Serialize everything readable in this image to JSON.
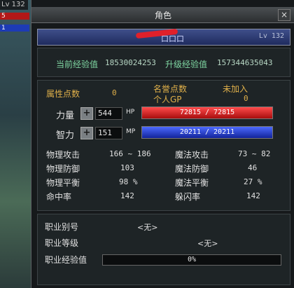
{
  "sidebar": {
    "level": "Lv 132",
    "hp_num": "5",
    "mp_num": "1"
  },
  "window": {
    "title": "角色",
    "close": "×"
  },
  "name_bar": {
    "level": "Lv 132",
    "name": "口口口"
  },
  "experience": {
    "current_label": "当前经验值",
    "current_value": "18530024253",
    "levelup_label": "升级经验值",
    "levelup_value": "157344635043"
  },
  "points": {
    "attr_label": "属性点数",
    "attr_value": "0",
    "fame_label": "名誉点数",
    "fame_value": "未加入",
    "gp_label": "个人GP",
    "gp_value": "0"
  },
  "attributes": [
    {
      "label": "力量",
      "value": "544",
      "unit": "HP",
      "gauge_text": "72815 / 72815",
      "fill": 1.0,
      "type": "hp"
    },
    {
      "label": "智力",
      "value": "151",
      "unit": "MP",
      "gauge_text": "20211 / 20211",
      "fill": 1.0,
      "type": "mp"
    }
  ],
  "combat": {
    "left": [
      {
        "label": "物理攻击",
        "value": "166 ~ 186"
      },
      {
        "label": "物理防御",
        "value": "103"
      },
      {
        "label": "物理平衡",
        "value": "98 %"
      },
      {
        "label": "命中率",
        "value": "142"
      }
    ],
    "right": [
      {
        "label": "魔法攻击",
        "value": "73 ~ 82"
      },
      {
        "label": "魔法防御",
        "value": "46"
      },
      {
        "label": "魔法平衡",
        "value": "27 %"
      },
      {
        "label": "躲闪率",
        "value": "142"
      }
    ]
  },
  "job": {
    "type_label": "职业别号",
    "type_value": "<无>",
    "level_label": "职业等级",
    "level_value": "<无>",
    "exp_label": "职业经验值",
    "exp_value": "0%",
    "exp_fill": 0.0
  },
  "colors": {
    "hp": "#d02020",
    "mp": "#2040c0",
    "accent_gold": "#e0b04a",
    "accent_green": "#7fd6a2"
  }
}
